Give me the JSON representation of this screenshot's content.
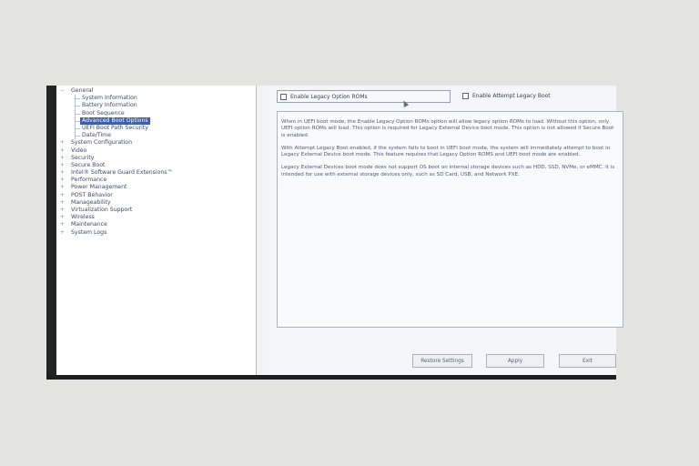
{
  "tree": [
    {
      "label": "General",
      "level": 0,
      "expander": "−"
    },
    {
      "label": "System Information",
      "level": 1
    },
    {
      "label": "Battery Information",
      "level": 1
    },
    {
      "label": "Boot Sequence",
      "level": 1
    },
    {
      "label": "Advanced Boot Options",
      "level": 1,
      "selected": true
    },
    {
      "label": "UEFI Boot Path Security",
      "level": 1
    },
    {
      "label": "Date/Time",
      "level": 1
    },
    {
      "label": "System Configuration",
      "level": 0,
      "expander": "+"
    },
    {
      "label": "Video",
      "level": 0,
      "expander": "+"
    },
    {
      "label": "Security",
      "level": 0,
      "expander": "+"
    },
    {
      "label": "Secure Boot",
      "level": 0,
      "expander": "+"
    },
    {
      "label": "Intel® Software Guard Extensions™",
      "level": 0,
      "expander": "+"
    },
    {
      "label": "Performance",
      "level": 0,
      "expander": "+"
    },
    {
      "label": "Power Management",
      "level": 0,
      "expander": "+"
    },
    {
      "label": "POST Behavior",
      "level": 0,
      "expander": "+"
    },
    {
      "label": "Manageability",
      "level": 0,
      "expander": "+"
    },
    {
      "label": "Virtualization Support",
      "level": 0,
      "expander": "+"
    },
    {
      "label": "Wireless",
      "level": 0,
      "expander": "+"
    },
    {
      "label": "Maintenance",
      "level": 0,
      "expander": "+"
    },
    {
      "label": "System Logs",
      "level": 0,
      "expander": "+"
    }
  ],
  "options": {
    "legacy_roms": {
      "label": "Enable Legacy Option ROMs",
      "checked": false
    },
    "attempt_legacy": {
      "label": "Enable Attempt Legacy Boot",
      "checked": false
    }
  },
  "description": {
    "p1": "When in UEFI boot mode, the Enable Legacy Option ROMs option will allow legacy option ROMs to load. Without this option, only UEFI option ROMs will load. This option is required for Legacy External Device boot mode. This option is not allowed if Secure Boot is enabled.",
    "p2": "With Attempt Legacy Boot enabled, if the system fails to boot in UEFI boot mode, the system will immediately attempt to boot in Legacy External Device boot mode. This feature requires that Legacy Option ROMS and UEFI boot mode are enabled.",
    "p3": "Legacy External Devices boot mode does not support OS boot on internal storage devices such as HDD, SSD, NVMe, or eMMC. It is intended for use with external storage devices only, such as SD Card, USB, and Network PXE."
  },
  "buttons": {
    "restore": "Restore Settings",
    "apply": "Apply",
    "exit": "Exit"
  }
}
